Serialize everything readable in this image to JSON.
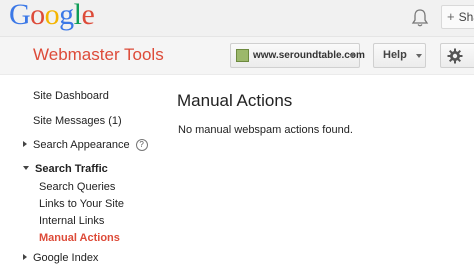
{
  "topbar": {
    "logo": {
      "g1": "G",
      "o1": "o",
      "o2": "o",
      "g2": "g",
      "l": "l",
      "e": "e"
    },
    "share_plus": "+",
    "share_label": "Sha"
  },
  "header": {
    "product_title": "Webmaster Tools",
    "site_selector": "www.seroundtable.com",
    "help_label": "Help"
  },
  "sidebar": {
    "items": [
      {
        "label": "Site Dashboard"
      },
      {
        "label": "Site Messages (1)"
      },
      {
        "label": "Search Appearance",
        "help_icon": "?"
      },
      {
        "label": "Search Traffic"
      },
      {
        "label": "Search Queries"
      },
      {
        "label": "Links to Your Site"
      },
      {
        "label": "Internal Links"
      },
      {
        "label": "Manual Actions"
      },
      {
        "label": "Google Index"
      }
    ]
  },
  "main": {
    "title": "Manual Actions",
    "message": "No manual webspam actions found."
  },
  "colors": {
    "brand_red": "#dd4b39",
    "google_blue": "#3b78e7"
  }
}
